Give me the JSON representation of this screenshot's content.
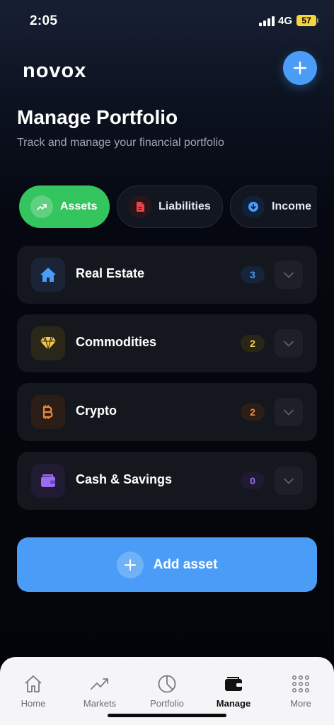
{
  "status_bar": {
    "time": "2:05",
    "network": "4G",
    "battery": "57"
  },
  "header": {
    "logo": "novox",
    "add_icon": "plus-icon"
  },
  "page": {
    "title": "Manage Portfolio",
    "subtitle": "Track and manage your financial portfolio"
  },
  "tabs": [
    {
      "label": "Assets",
      "icon": "trending-up-icon",
      "active": true
    },
    {
      "label": "Liabilities",
      "icon": "document-icon",
      "active": false
    },
    {
      "label": "Income",
      "icon": "arrow-down-circle-icon",
      "active": false
    }
  ],
  "categories": [
    {
      "label": "Real Estate",
      "count": "3",
      "icon": "home-icon",
      "color": "#4a9cf7"
    },
    {
      "label": "Commodities",
      "count": "2",
      "icon": "diamond-icon",
      "color": "#f2c94c"
    },
    {
      "label": "Crypto",
      "count": "2",
      "icon": "bitcoin-icon",
      "color": "#f08a35"
    },
    {
      "label": "Cash & Savings",
      "count": "0",
      "icon": "wallet-icon",
      "color": "#9b6cf2"
    }
  ],
  "add_button": {
    "label": "Add asset"
  },
  "bottom_nav": [
    {
      "label": "Home",
      "icon": "home-icon"
    },
    {
      "label": "Markets",
      "icon": "trending-up-icon"
    },
    {
      "label": "Portfolio",
      "icon": "pie-chart-icon"
    },
    {
      "label": "Manage",
      "icon": "wallet-icon",
      "active": true
    },
    {
      "label": "More",
      "icon": "grid-icon"
    }
  ],
  "colors": {
    "accent": "#4a9cf7",
    "active_tab": "#35c55e",
    "background": "#050810",
    "card": "#15171e"
  }
}
